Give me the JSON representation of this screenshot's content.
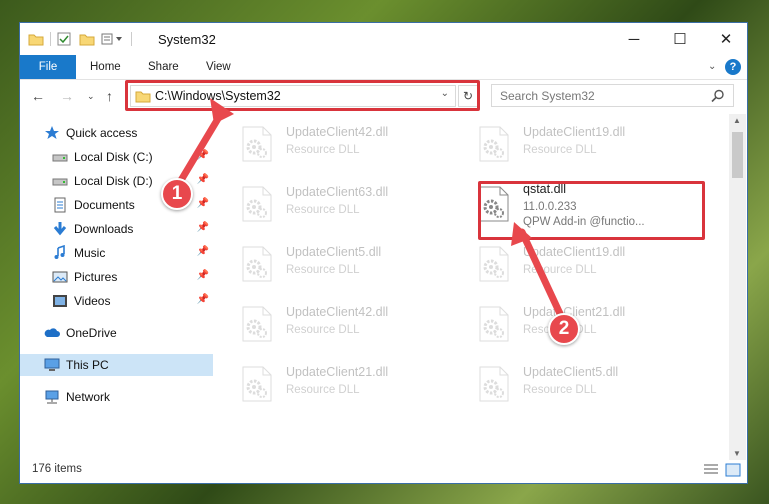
{
  "window": {
    "title": "System32",
    "minimize": "─",
    "maximize": "☐",
    "close": "✕"
  },
  "ribbon": {
    "tabs": [
      "File",
      "Home",
      "Share",
      "View"
    ],
    "help": "?"
  },
  "nav": {
    "address": "C:\\Windows\\System32",
    "search_placeholder": "Search System32"
  },
  "sidebar": {
    "items": [
      {
        "label": "Quick access",
        "icon": "star-icon",
        "pinned": false
      },
      {
        "label": "Local Disk (C:)",
        "icon": "drive-icon",
        "pinned": true
      },
      {
        "label": "Local Disk (D:)",
        "icon": "drive-icon",
        "pinned": true
      },
      {
        "label": "Documents",
        "icon": "documents-icon",
        "pinned": true
      },
      {
        "label": "Downloads",
        "icon": "download-icon",
        "pinned": true
      },
      {
        "label": "Music",
        "icon": "music-icon",
        "pinned": true
      },
      {
        "label": "Pictures",
        "icon": "pictures-icon",
        "pinned": true
      },
      {
        "label": "Videos",
        "icon": "videos-icon",
        "pinned": true
      },
      {
        "label": "OneDrive",
        "icon": "cloud-icon",
        "pinned": false
      },
      {
        "label": "This PC",
        "icon": "computer-icon",
        "pinned": false,
        "selected": true
      },
      {
        "label": "Network",
        "icon": "network-icon",
        "pinned": false
      }
    ]
  },
  "files": [
    {
      "name": "UpdateClient42.dll",
      "sub": "Resource DLL",
      "col": 0,
      "row": 0
    },
    {
      "name": "UpdateClient19.dll",
      "sub": "Resource DLL",
      "col": 1,
      "row": 0
    },
    {
      "name": "UpdateClient63.dll",
      "sub": "Resource DLL",
      "col": 0,
      "row": 1
    },
    {
      "name": "qstat.dll",
      "sub": "11.0.0.233",
      "sub2": "QPW Add-in @functio...",
      "col": 1,
      "row": 1,
      "highlight": true
    },
    {
      "name": "UpdateClient5.dll",
      "sub": "Resource DLL",
      "col": 0,
      "row": 2
    },
    {
      "name": "UpdateClient19.dll",
      "sub": "Resource DLL",
      "col": 1,
      "row": 2
    },
    {
      "name": "UpdateClient42.dll",
      "sub": "Resource DLL",
      "col": 0,
      "row": 3
    },
    {
      "name": "UpdateClient21.dll",
      "sub": "Resource DLL",
      "col": 1,
      "row": 3
    },
    {
      "name": "UpdateClient21.dll",
      "sub": "Resource DLL",
      "col": 0,
      "row": 4
    },
    {
      "name": "UpdateClient5.dll",
      "sub": "Resource DLL",
      "col": 1,
      "row": 4
    }
  ],
  "status": {
    "count": "176 items"
  },
  "callouts": {
    "one": "1",
    "two": "2"
  },
  "colors": {
    "accent": "#1979ca",
    "highlight": "#d9343c",
    "selection": "#cce4f7"
  }
}
